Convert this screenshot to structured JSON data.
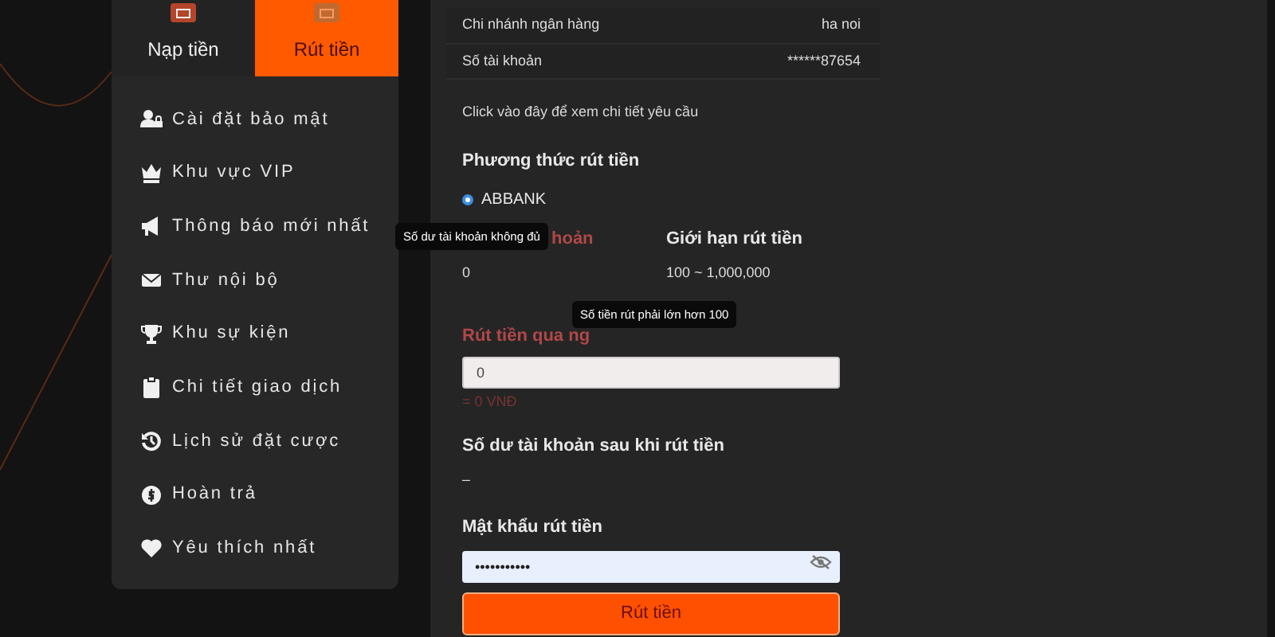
{
  "tabs": [
    {
      "label": "Nạp tiền",
      "selected": false
    },
    {
      "label": "Rút tiền",
      "selected": true
    }
  ],
  "menu": [
    {
      "label": "Cài đặt bảo mật"
    },
    {
      "label": "Khu vực VIP"
    },
    {
      "label": "Thông báo mới nhất"
    },
    {
      "label": "Thư nội bộ"
    },
    {
      "label": "Khu sự kiện"
    },
    {
      "label": "Chi tiết giao dịch"
    },
    {
      "label": "Lịch sử đặt cược"
    },
    {
      "label": "Hoàn trả"
    },
    {
      "label": "Yêu thích nhất"
    }
  ],
  "bank_info": [
    {
      "label": "Chi nhánh ngân hàng",
      "value": "ha noi"
    },
    {
      "label": "Số tài khoản",
      "value": "******87654"
    }
  ],
  "details_link": "Click vào đây để xem chi tiết yêu cầu",
  "method": {
    "title": "Phương thức rút tiền",
    "options": [
      {
        "label": "ABBANK",
        "selected": true
      }
    ]
  },
  "balance": {
    "label": "hoản",
    "value": "0"
  },
  "limit": {
    "label": "Giới hạn rút tiền",
    "value": "100 ~ 1,000,000"
  },
  "amount": {
    "label": "Rút tiền qua ng",
    "value": "0",
    "conversion": "= 0 VNĐ"
  },
  "after_balance": {
    "label": "Số dư tài khoản sau khi rút tiền",
    "value": "–"
  },
  "password": {
    "label": "Mật khẩu rút tiền",
    "value": "•••••••••••"
  },
  "submit": "Rút tiền",
  "tooltips": [
    {
      "text": "Số dư tài khoản không đủ"
    },
    {
      "text": "Số tiền rút phải lớn hơn 100"
    }
  ]
}
